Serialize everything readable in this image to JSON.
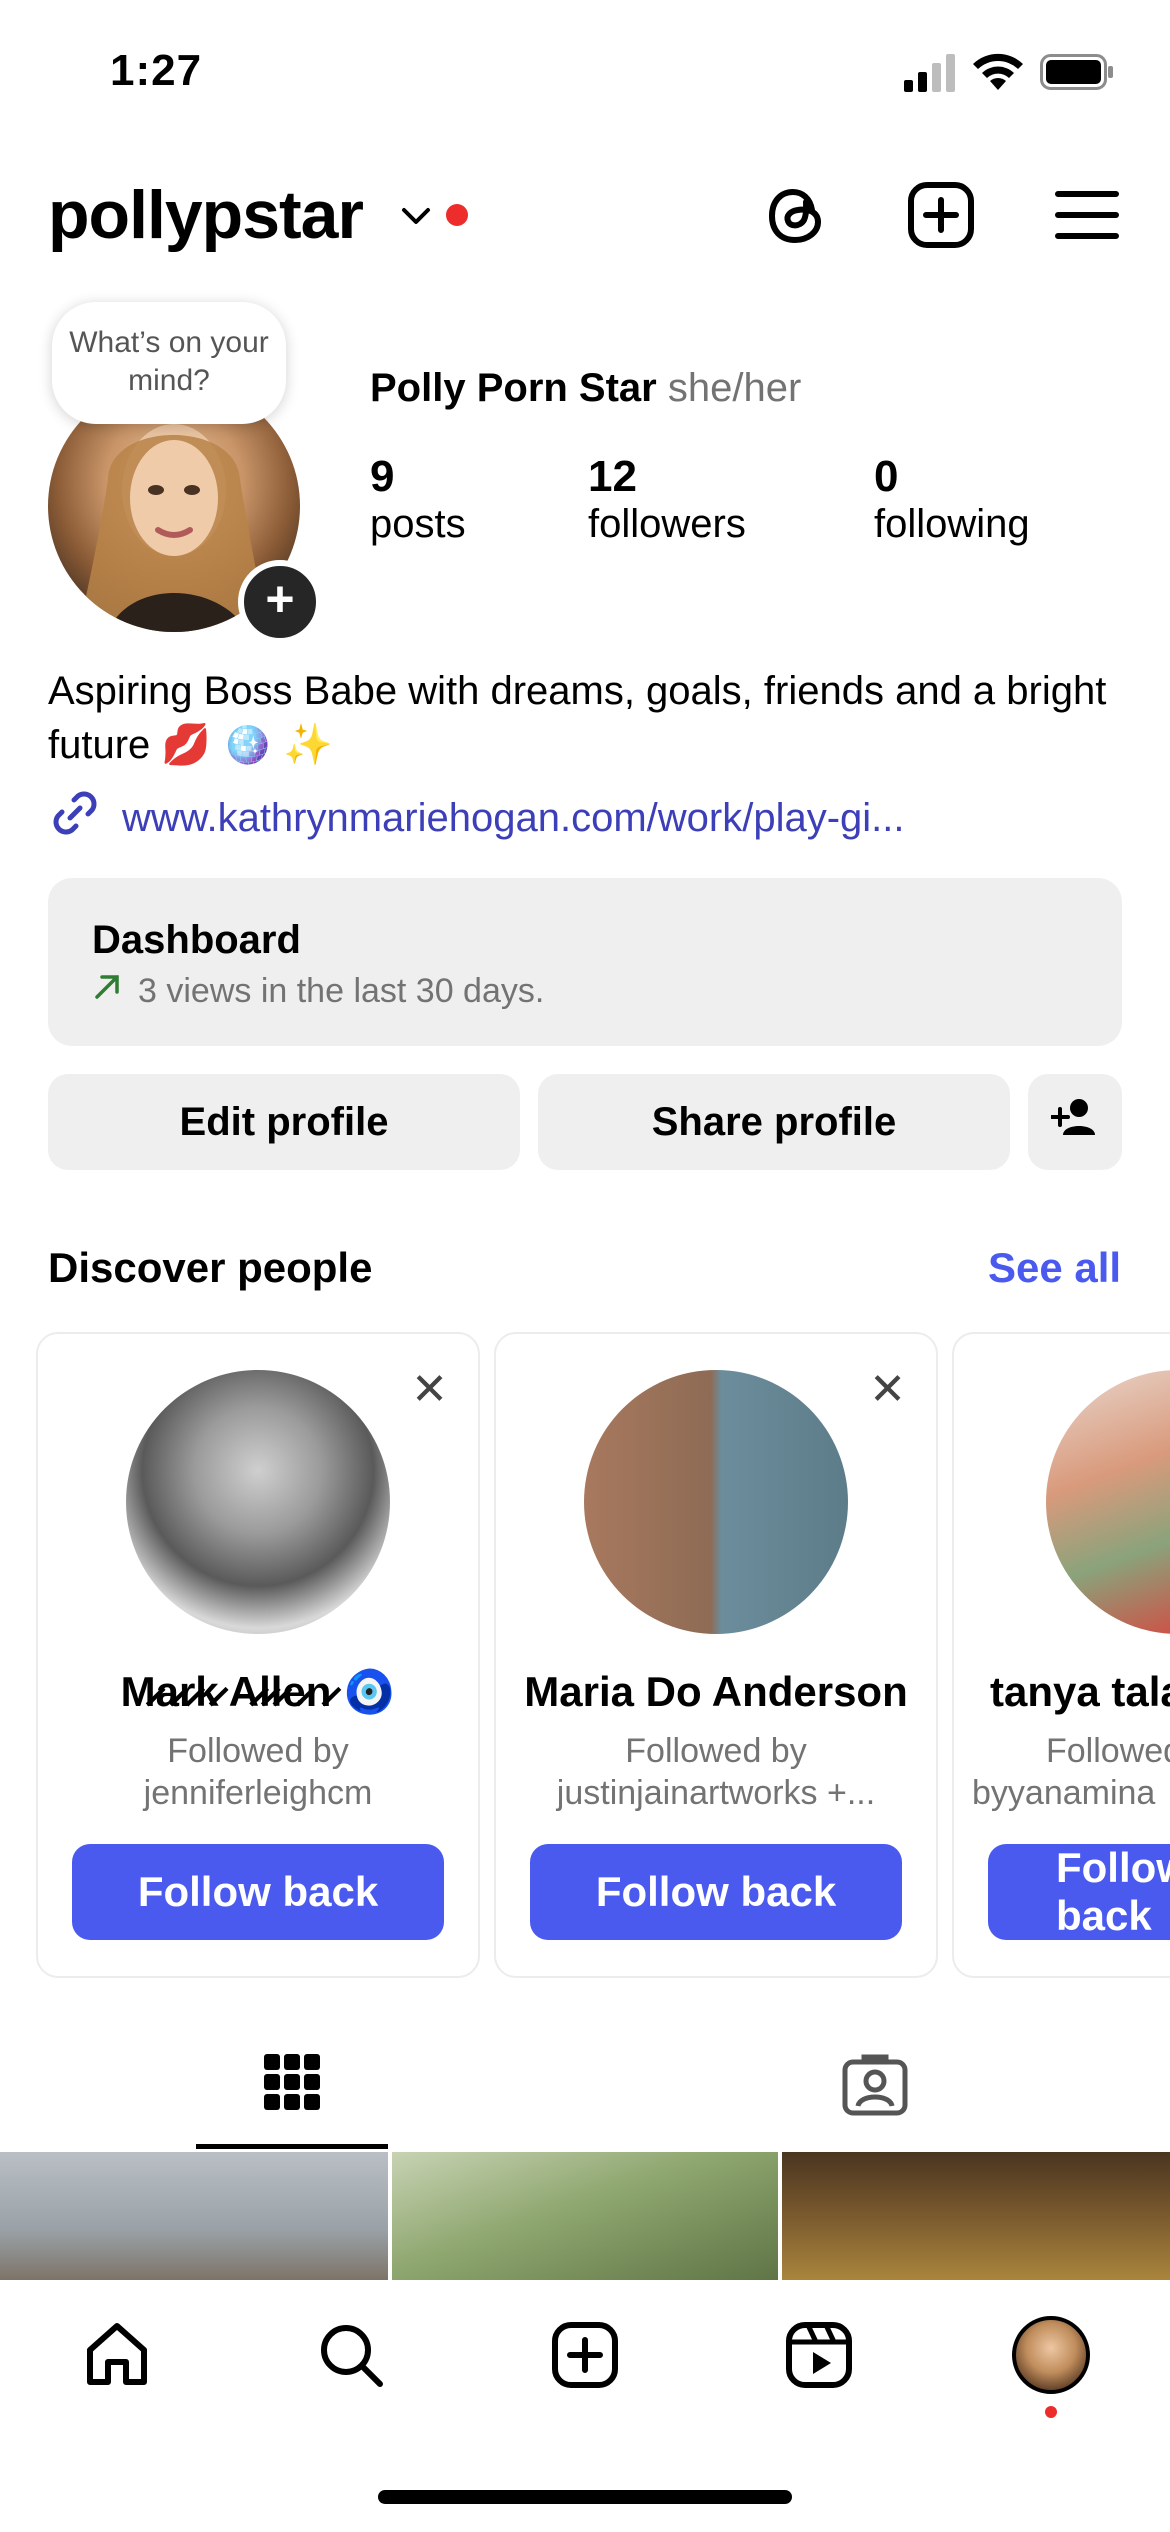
{
  "status_bar": {
    "time": "1:27"
  },
  "header": {
    "username": "pollypstar"
  },
  "profile": {
    "note_bubble": "What’s on your mind?",
    "display_name": "Polly Porn Star",
    "pronouns": "she/her",
    "stats": [
      {
        "value": "9",
        "label": "posts"
      },
      {
        "value": "12",
        "label": "followers"
      },
      {
        "value": "0",
        "label": "following"
      }
    ],
    "bio": "Aspiring Boss Babe with dreams, goals, friends and a bright future 💋 🪩 ✨",
    "link": "www.kathrynmariehogan.com/work/play-gi..."
  },
  "dashboard": {
    "title": "Dashboard",
    "subtitle": "3 views in the last 30 days."
  },
  "actions": {
    "edit_profile": "Edit profile",
    "share_profile": "Share profile"
  },
  "discover": {
    "title": "Discover people",
    "see_all": "See all",
    "cards": [
      {
        "name": "M̷a̷r̷k̷ A̷l̷l̷e̷n̷ 🧿",
        "followed_by_1": "Followed by",
        "followed_by_2": "jenniferleighcm",
        "button": "Follow back"
      },
      {
        "name": "Maria Do Anderson",
        "followed_by_1": "Followed by",
        "followed_by_2": "justinjainartworks +...",
        "button": "Follow back"
      },
      {
        "name": "tanya tala",
        "followed_by_1": "Followed",
        "followed_by_2": "byyanamina",
        "button": "Follow back"
      }
    ]
  },
  "colors": {
    "accent": "#4a5aef",
    "link": "#3c3fb8",
    "notification_dot": "#ed2c2c",
    "secondary_text": "#737373",
    "surface": "#efefef"
  }
}
